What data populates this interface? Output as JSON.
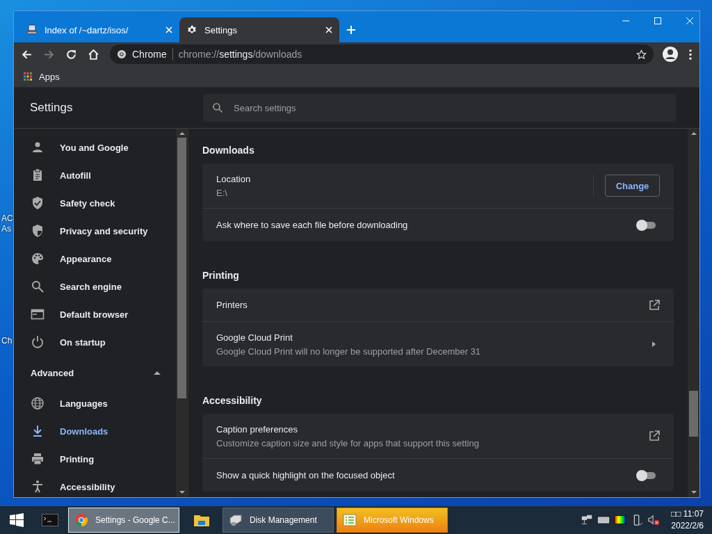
{
  "desktop": {
    "icon_labels": [
      {
        "text": "AC"
      },
      {
        "text": "As"
      },
      {
        "text": "Ch"
      }
    ]
  },
  "browser": {
    "tabs": [
      {
        "title": "Index of /~dartz/isos/",
        "selected": false
      },
      {
        "title": "Settings",
        "selected": true
      }
    ],
    "omnibox": {
      "origin": "Chrome",
      "url_prefix": "chrome://",
      "url_host": "settings",
      "url_path": "/downloads"
    },
    "bookmarks": [
      {
        "label": "Apps"
      }
    ]
  },
  "settings": {
    "title": "Settings",
    "search": {
      "placeholder": "Search settings"
    },
    "sidebar": {
      "items": [
        {
          "label": "You and Google",
          "selected": false
        },
        {
          "label": "Autofill",
          "selected": false
        },
        {
          "label": "Safety check",
          "selected": false
        },
        {
          "label": "Privacy and security",
          "selected": false
        },
        {
          "label": "Appearance",
          "selected": false
        },
        {
          "label": "Search engine",
          "selected": false
        },
        {
          "label": "Default browser",
          "selected": false
        },
        {
          "label": "On startup",
          "selected": false
        }
      ],
      "advanced": {
        "label": "Advanced",
        "expanded": true,
        "items": [
          {
            "label": "Languages",
            "selected": false
          },
          {
            "label": "Downloads",
            "selected": true
          },
          {
            "label": "Printing",
            "selected": false
          },
          {
            "label": "Accessibility",
            "selected": false
          }
        ]
      }
    },
    "sections": [
      {
        "title": "Downloads",
        "rows": [
          {
            "kind": "location",
            "label": "Location",
            "value": "E:\\",
            "button": "Change"
          },
          {
            "kind": "toggle",
            "label": "Ask where to save each file before downloading",
            "on": false
          }
        ]
      },
      {
        "title": "Printing",
        "rows": [
          {
            "kind": "external",
            "label": "Printers"
          },
          {
            "kind": "arrow",
            "label": "Google Cloud Print",
            "sublabel": "Google Cloud Print will no longer be supported after December 31"
          }
        ]
      },
      {
        "title": "Accessibility",
        "rows": [
          {
            "kind": "external",
            "label": "Caption preferences",
            "sublabel": "Customize caption size and style for apps that support this setting"
          },
          {
            "kind": "toggle",
            "label": "Show a quick highlight on the focused object",
            "on": false
          }
        ]
      }
    ]
  },
  "taskbar": {
    "items": [
      {
        "label": "Settings - Google C...",
        "selected": true,
        "flashing": false
      },
      {
        "label": "Disk Management",
        "selected": false,
        "flashing": false
      },
      {
        "label": "Microsoft Windows",
        "selected": false,
        "flashing": true
      }
    ],
    "clock": {
      "time": "□□ 11:07",
      "date": "2022/2/6"
    }
  }
}
